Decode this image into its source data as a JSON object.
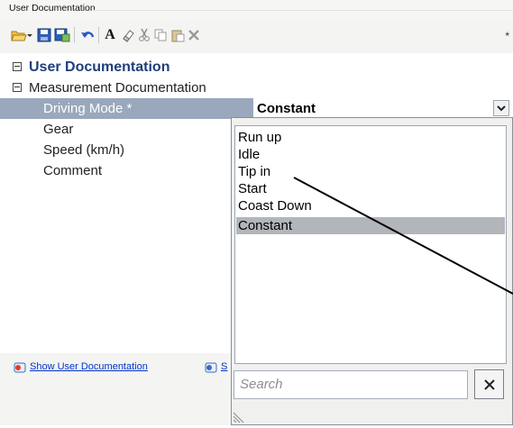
{
  "window": {
    "title": "User Documentation"
  },
  "toolbar": {
    "icons": [
      "open-icon",
      "save-icon",
      "save-as-icon",
      "undo-icon",
      "font-icon",
      "eraser-icon",
      "cut-icon",
      "copy-icon",
      "paste-icon",
      "delete-icon"
    ],
    "modified_marker": "*"
  },
  "grid": {
    "category": "User Documentation",
    "subcategory": "Measurement Documentation",
    "properties": [
      {
        "label": "Driving Mode *",
        "value": "Constant"
      },
      {
        "label": "Gear",
        "value": ""
      },
      {
        "label": "Speed (km/h)",
        "value": ""
      },
      {
        "label": "Comment",
        "value": ""
      }
    ]
  },
  "links": {
    "show_user_doc": "Show User Documentation",
    "second_partial": "S"
  },
  "dropdown": {
    "options": [
      "Run up",
      "Idle",
      "Tip in",
      "Start",
      "Coast Down",
      "Constant"
    ],
    "selected": "Constant",
    "search_placeholder": "Search",
    "clear_label": "✕"
  },
  "colors": {
    "selected_row": "#99a8bc",
    "selected_option": "#b2b5ba",
    "link": "#0033cc"
  }
}
